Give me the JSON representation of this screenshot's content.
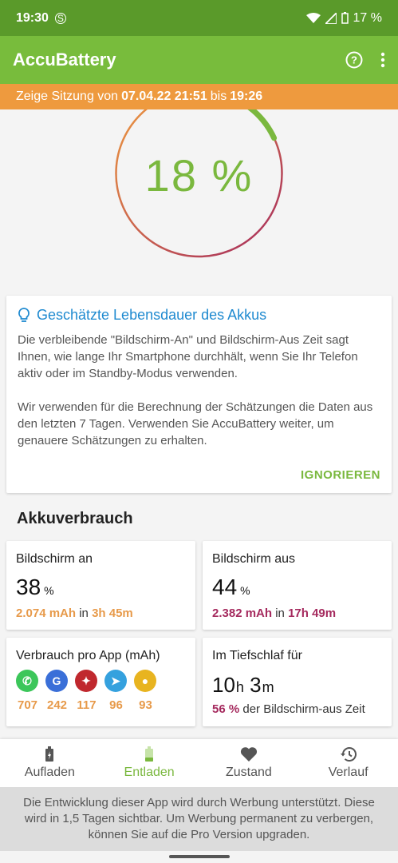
{
  "status_bar": {
    "time": "19:30",
    "carrier_icon": "S",
    "battery": "17 %"
  },
  "app_bar": {
    "title": "AccuBattery",
    "help_icon": "help-circle-icon",
    "more_icon": "more-vert-icon"
  },
  "session": {
    "prefix": "Zeige Sitzung von",
    "start": "07.04.22 21:51",
    "middle": "bis",
    "end": "19:26"
  },
  "gauge": {
    "percent_label": "18 %",
    "level_fraction": 0.18
  },
  "estimate_card": {
    "title": "Geschätzte Lebensdauer des Akkus",
    "paragraph1": "Die verbleibende \"Bildschirm-An\" und Bildschirm-Aus Zeit sagt Ihnen, wie lange Ihr Smartphone durchhält, wenn Sie Ihr Telefon aktiv oder im Standby-Modus verwenden.",
    "paragraph2": "Wir verwenden für die Berechnung der Schätzungen die Daten aus den letzten 7 Tagen. Verwenden Sie AccuBattery weiter, um genauere Schätzungen zu erhalten.",
    "ignore_label": "IGNORIEREN"
  },
  "usage": {
    "section_title": "Akkuverbrauch",
    "screen_on": {
      "label": "Bildschirm an",
      "value": "38",
      "unit": "%",
      "mah": "2.074 mAh",
      "in": "in",
      "duration": "3h 45m"
    },
    "screen_off": {
      "label": "Bildschirm aus",
      "value": "44",
      "unit": "%",
      "mah": "2.382 mAh",
      "in": "in",
      "duration": "17h 49m"
    },
    "per_app": {
      "label": "Verbrauch pro App (mAh)",
      "apps": [
        {
          "icon": "whatsapp-icon",
          "glyph": "✆",
          "color": "#3cc65a",
          "value": "707"
        },
        {
          "icon": "google-icon",
          "glyph": "G",
          "color": "#3a6fd8",
          "value": "242"
        },
        {
          "icon": "app-red-icon",
          "glyph": "✦",
          "color": "#c0282e",
          "value": "117"
        },
        {
          "icon": "telegram-icon",
          "glyph": "➤",
          "color": "#35a1de",
          "value": "96"
        },
        {
          "icon": "chrome-icon",
          "glyph": "●",
          "color": "#e8b420",
          "value": "93"
        }
      ]
    },
    "deep_sleep": {
      "label": "Im Tiefschlaf für",
      "hours": "10",
      "h": "h",
      "minutes": "3",
      "m": "m",
      "percent": "56 %",
      "suffix": "der Bildschirm-aus Zeit"
    }
  },
  "bottom_nav": {
    "tabs": [
      {
        "label": "Aufladen",
        "icon": "battery-charging-icon"
      },
      {
        "label": "Entladen",
        "icon": "battery-icon"
      },
      {
        "label": "Zustand",
        "icon": "heart-icon"
      },
      {
        "label": "Verlauf",
        "icon": "history-icon"
      }
    ],
    "active_index": 1
  },
  "ad_notice": "Die Entwicklung dieser App wird durch Werbung unterstützt. Diese wird in 1,5 Tagen sichtbar. Um Werbung permanent zu verbergen, können Sie auf die Pro Version upgraden.",
  "colors": {
    "accent": "#78bc3c",
    "orange": "#ee9a3e",
    "wine": "#a52a5e",
    "link": "#1f8ad0"
  }
}
